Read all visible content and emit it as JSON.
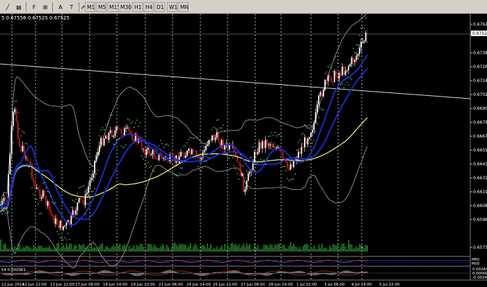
{
  "toolbar": {
    "drawing_tools": [
      {
        "name": "trend-line-tool",
        "glyph": "╱"
      },
      {
        "name": "equidistant-channel-tool",
        "glyph": "▤"
      },
      {
        "name": "fibonacci-tool",
        "glyph": "F"
      },
      {
        "name": "gann-tool",
        "glyph": "⊞"
      },
      {
        "name": "text-tool",
        "glyph": "A"
      },
      {
        "name": "text-label-tool",
        "glyph": "T"
      },
      {
        "name": "arrow-tool",
        "glyph": "⇗"
      }
    ],
    "timeframes": [
      "M1",
      "M5",
      "M15",
      "M30",
      "H1",
      "H4",
      "D1",
      "W1",
      "MN"
    ]
  },
  "chart": {
    "header": "5 0.67556 0.67525 0.67525",
    "price_labels": [
      "0.67620",
      "0.67525",
      "0.67380",
      "0.67260",
      "0.67145",
      "0.67025",
      "0.66905",
      "0.66790",
      "0.66670",
      "0.66550",
      "0.66435",
      "0.66315",
      "0.66195",
      "0.66080",
      "0.65960",
      "0.65730"
    ],
    "date_labels": [
      "12 Jun 2014",
      "12 Jun 22:00",
      "13 Jun 22:00",
      "17 Jun 06:00",
      "18 Jun 14:00",
      "19 Jun 22:00",
      "21 Jun 06:00",
      "24 Jun 14:00",
      "25 Jun 22:00",
      "27 Jun 06:00",
      "28 Jun 14:00",
      "1 Jul 22:00",
      "3 Jul 06:00",
      "4 Jul 14:00",
      "5 Jul 22:00"
    ],
    "volume_levels": [
      "MR0",
      "MV0"
    ],
    "oscillator": {
      "title": "54 0.002961",
      "levels": [
        "0.00264",
        "0.00000",
        "-0.00248"
      ]
    },
    "colors": {
      "background": "#000000",
      "bull_candle": "#ffffff",
      "bear_candle": "#c02020",
      "ma_fast": "#1a2fd6",
      "ma_slow": "#e8e878",
      "bollinger": "#a8a8a8",
      "parabolic_sar": "#7cfc7c",
      "volume": "#2f8f2f",
      "trendline": "#d8d8d8",
      "grid": "#ffffff"
    }
  }
}
